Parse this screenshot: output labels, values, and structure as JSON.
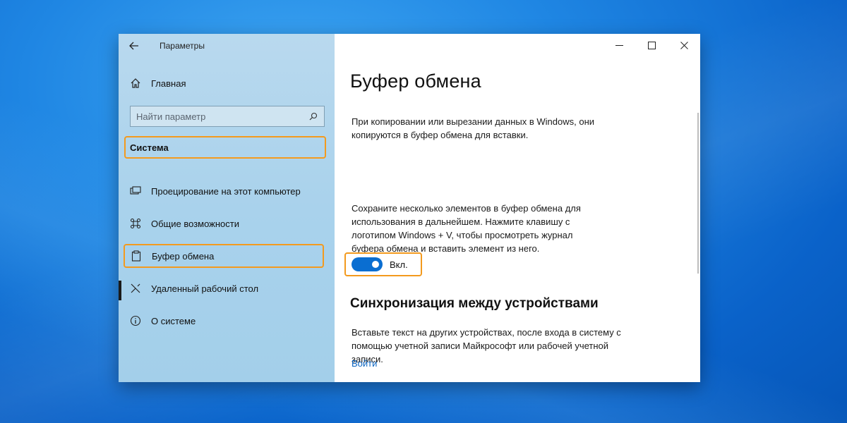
{
  "window": {
    "title": "Параметры",
    "controls": {
      "minimize": "—",
      "maximize": "☐",
      "close": "✕"
    }
  },
  "sidebar": {
    "home_label": "Главная",
    "search_placeholder": "Найти параметр",
    "section": "Система",
    "items": [
      {
        "label": "Проецирование на этот компьютер",
        "icon": "projector-icon"
      },
      {
        "label": "Общие возможности",
        "icon": "shared-experiences-icon"
      },
      {
        "label": "Буфер обмена",
        "icon": "clipboard-icon",
        "active": true
      },
      {
        "label": "Удаленный рабочий стол",
        "icon": "remote-desktop-icon"
      },
      {
        "label": "О системе",
        "icon": "info-icon"
      }
    ]
  },
  "main": {
    "title": "Буфер обмена",
    "intro": "При копировании или вырезании данных в Windows, они копируются в буфер обмена для вставки.",
    "history_text": "Сохраните несколько элементов в буфер обмена для использования в дальнейшем. Нажмите клавишу с логотипом Windows + V, чтобы просмотреть журнал буфера обмена и вставить элемент из него.",
    "toggle": {
      "state": "on",
      "label": "Вкл."
    },
    "sync_title": "Синхронизация между устройствами",
    "sync_text": "Вставьте текст на других устройствах, после входа в систему с помощью учетной записи Майкрософт или рабочей учетной записи.",
    "sync_link": "Войти"
  },
  "colors": {
    "accent": "#0a6ed1",
    "highlight": "#f39a1e",
    "sidebar_bg": "#aed4ec",
    "link": "#0b64c0"
  }
}
